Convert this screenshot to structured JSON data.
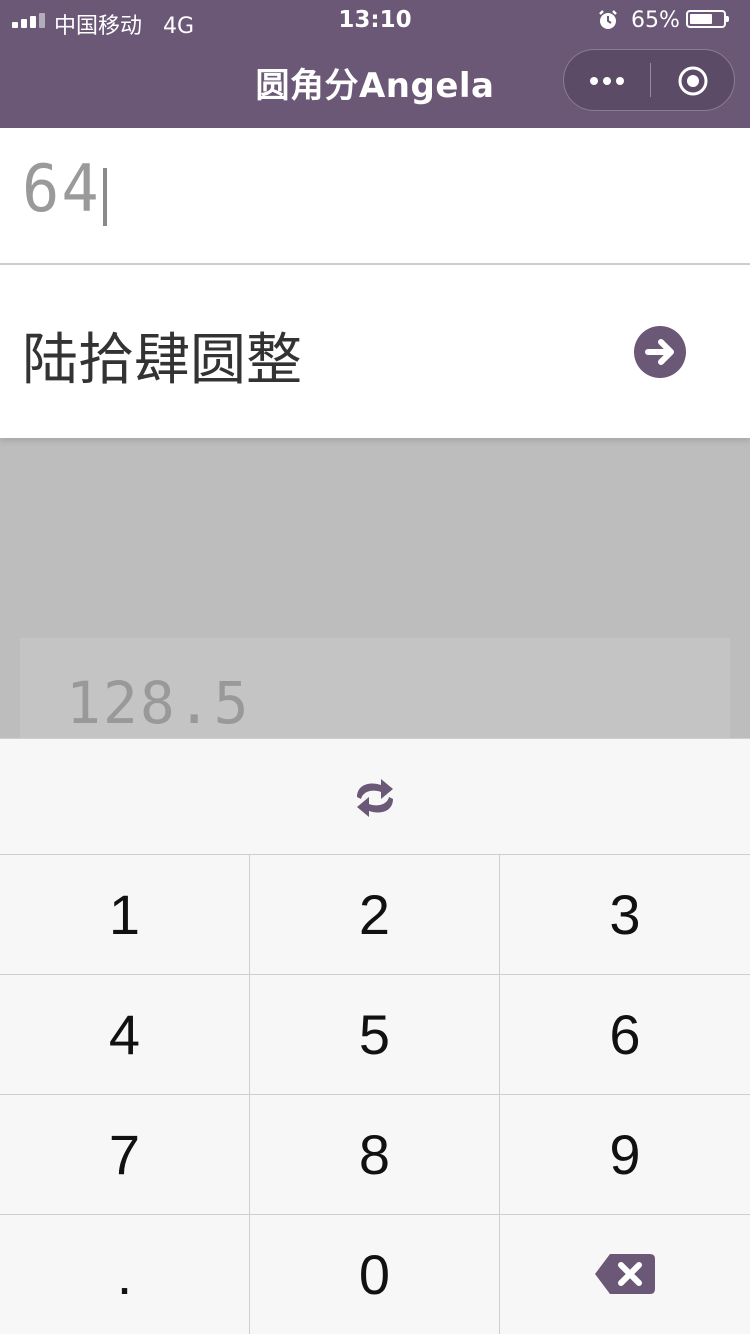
{
  "status_bar": {
    "carrier": "中国移动",
    "network": "4G",
    "time": "13:10",
    "battery_percent": "65%",
    "battery_level": 0.65
  },
  "nav": {
    "title": "圆角分Angela",
    "more_icon": "more-dots-icon",
    "close_icon": "target-circle-icon"
  },
  "input": {
    "amount": "64"
  },
  "result": {
    "chinese_words": "陆拾肆圆整",
    "go_icon": "arrow-right-circle-icon"
  },
  "history": {
    "value": "128.5"
  },
  "keypad": {
    "swap_icon": "swap-arrows-icon",
    "keys": [
      "1",
      "2",
      "3",
      "4",
      "5",
      "6",
      "7",
      "8",
      "9",
      ".",
      "0"
    ],
    "delete_icon": "backspace-icon"
  },
  "colors": {
    "brand": "#6b5877",
    "lcd_text": "#9a9a9a",
    "keypad_bg": "#f7f7f7"
  }
}
